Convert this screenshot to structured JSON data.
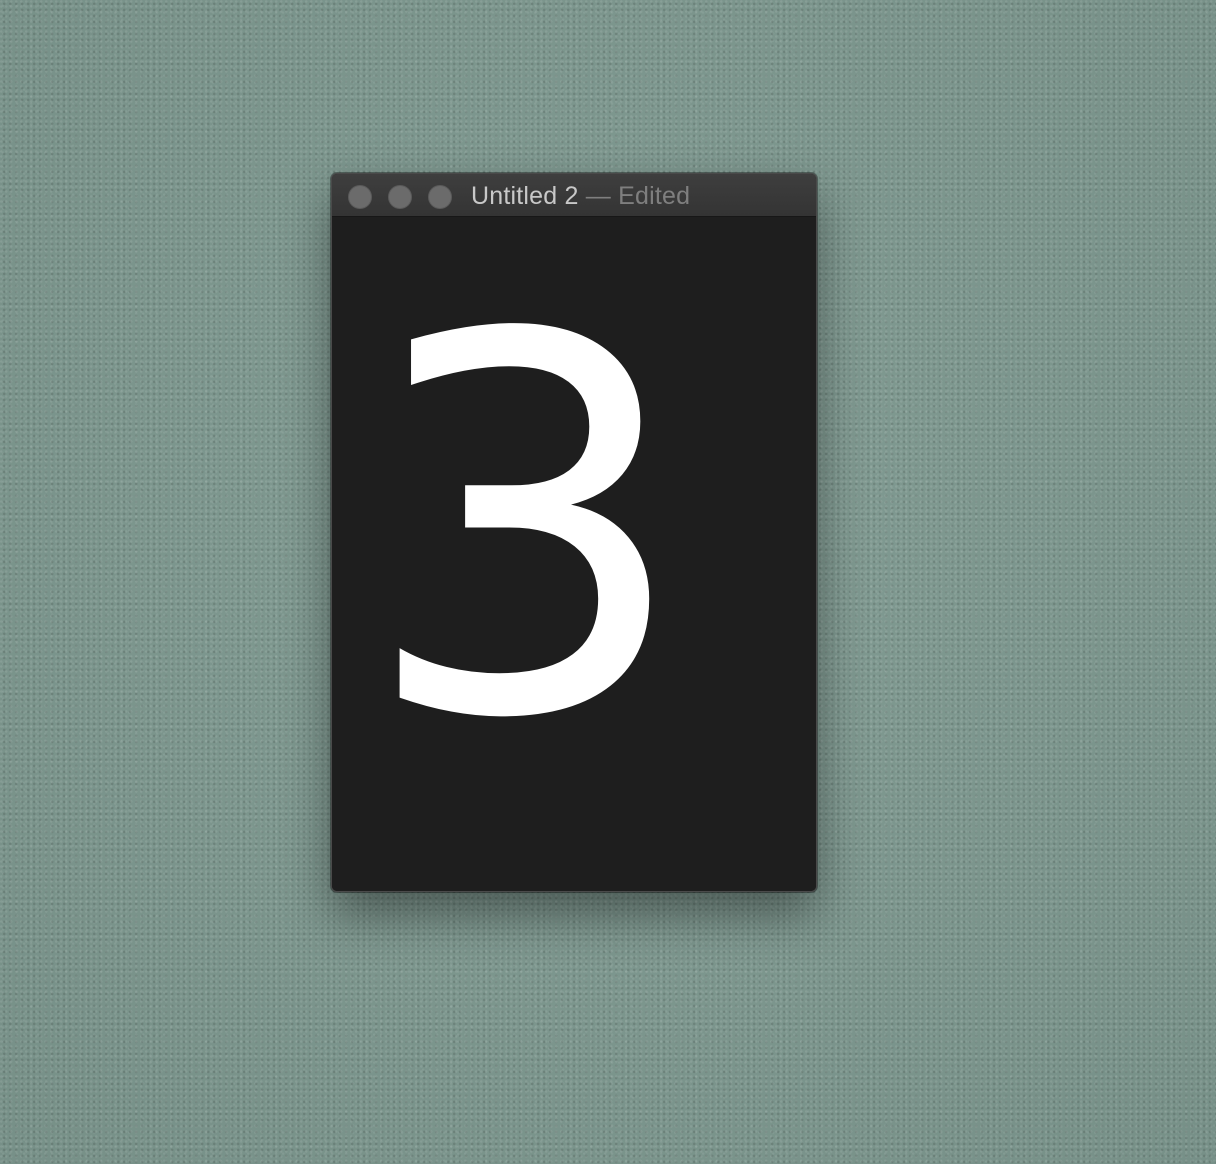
{
  "window": {
    "title": "Untitled 2",
    "separator": "—",
    "status": "Edited",
    "traffic_lights": {
      "close": "close-button",
      "minimize": "minimize-button",
      "zoom": "zoom-button"
    }
  },
  "document": {
    "text": "3"
  },
  "colors": {
    "desktop": "#7e9990",
    "window_background": "#1e1e1e",
    "titlebar": "#3a3a3a",
    "text": "#ffffff",
    "traffic_light": "#6b6b6b"
  }
}
